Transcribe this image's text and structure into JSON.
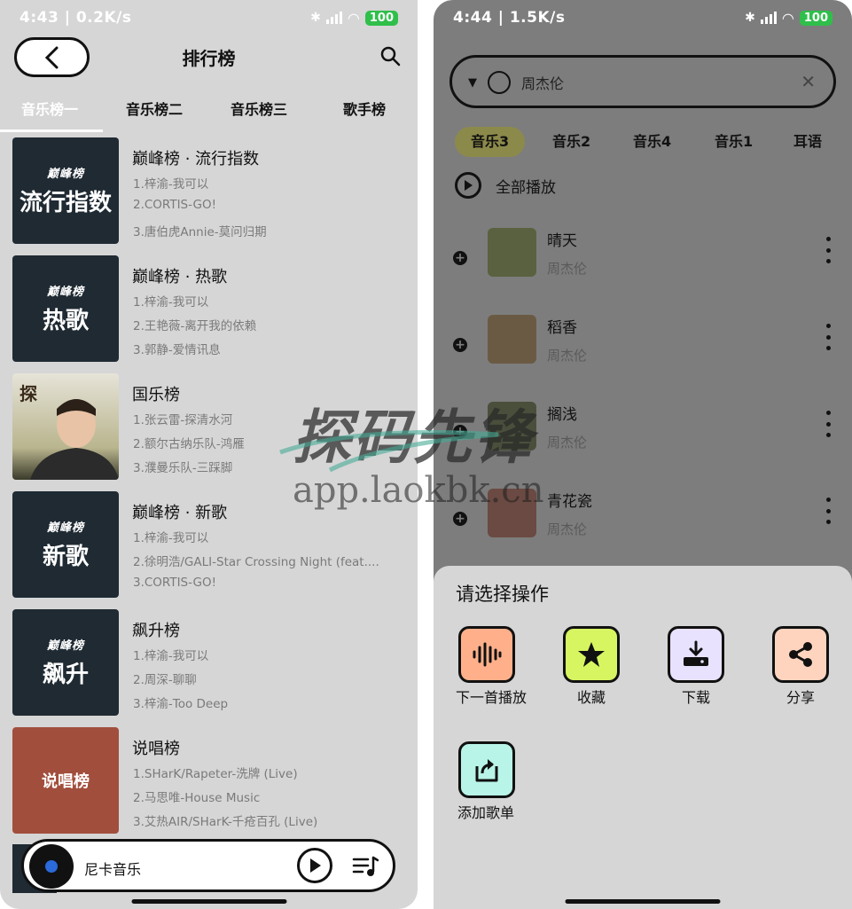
{
  "left": {
    "status": {
      "time": "4:43 | 0.2K/s",
      "battery": "100"
    },
    "title": "排行榜",
    "tabs": [
      "音乐榜一",
      "音乐榜二",
      "音乐榜三",
      "歌手榜"
    ],
    "ranks": [
      {
        "title": "巅峰榜 · 流行指数",
        "brand": "巅峰榜",
        "cover_text": "流行指数",
        "lines": [
          "1.梓渝-我可以",
          "2.CORTIS-GO!",
          "3.唐伯虎Annie-莫问归期"
        ]
      },
      {
        "title": "巅峰榜 · 热歌",
        "brand": "巅峰榜",
        "cover_text": "热歌",
        "lines": [
          "1.梓渝-我可以",
          "2.王艳薇-离开我的依赖",
          "3.郭静-爱情讯息"
        ]
      },
      {
        "title": "国乐榜",
        "brand": "",
        "cover_text": "",
        "lines": [
          "1.张云雷-探清水河",
          "2.额尔古纳乐队-鸿雁",
          "3.濮曼乐队-三踩脚"
        ]
      },
      {
        "title": "巅峰榜 · 新歌",
        "brand": "巅峰榜",
        "cover_text": "新歌",
        "lines": [
          "1.梓渝-我可以",
          "2.徐明浩/GALI-Star Crossing Night (feat....",
          "3.CORTIS-GO!"
        ]
      },
      {
        "title": "飙升榜",
        "brand": "巅峰榜",
        "cover_text": "飙升",
        "lines": [
          "1.梓渝-我可以",
          "2.周深-聊聊",
          "3.梓渝-Too Deep"
        ]
      },
      {
        "title": "说唱榜",
        "brand": "",
        "cover_text": "说唱榜",
        "lines": [
          "1.SHarK/Rapeter-洗牌 (Live)",
          "2.马思唯-House Music",
          "3.艾热AIR/SHarK-千疮百孔 (Live)"
        ]
      }
    ],
    "player": {
      "name": "尼卡音乐"
    }
  },
  "right": {
    "status": {
      "time": "4:44 | 1.5K/s",
      "battery": "100"
    },
    "search": {
      "value": "周杰伦"
    },
    "categories": [
      "音乐3",
      "音乐2",
      "音乐4",
      "音乐1",
      "耳语"
    ],
    "play_all": "全部播放",
    "songs": [
      {
        "title": "晴天",
        "artist": "周杰伦"
      },
      {
        "title": "稻香",
        "artist": "周杰伦"
      },
      {
        "title": "搁浅",
        "artist": "周杰伦"
      },
      {
        "title": "青花瓷",
        "artist": "周杰伦"
      }
    ],
    "sheet": {
      "title": "请选择操作",
      "ops": [
        {
          "label": "下一首播放",
          "icon": "waveform-icon",
          "color": "#ffb08a"
        },
        {
          "label": "收藏",
          "icon": "star-icon",
          "color": "#d6f561"
        },
        {
          "label": "下载",
          "icon": "download-icon",
          "color": "#e9e2ff"
        },
        {
          "label": "分享",
          "icon": "share-icon",
          "color": "#ffd4bf"
        },
        {
          "label": "添加歌单",
          "icon": "add-to-playlist-icon",
          "color": "#b8f4e8"
        }
      ]
    }
  },
  "watermark": {
    "logo": "探码先锋",
    "url": "app.laokbk.cn"
  }
}
